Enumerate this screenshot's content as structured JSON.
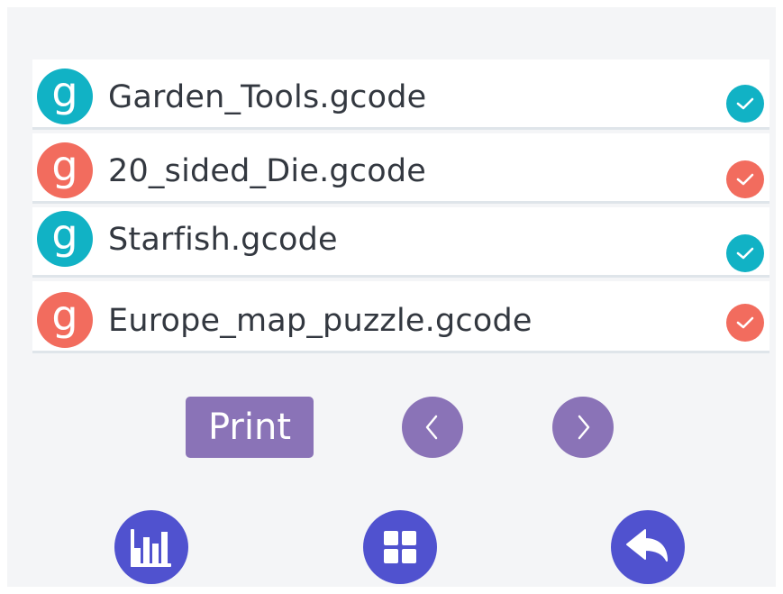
{
  "files": [
    {
      "name": "Garden_Tools.gcode",
      "icon_letter": "g",
      "color": "#11b2c5",
      "status": "check-icon"
    },
    {
      "name": "20_sided_Die.gcode",
      "icon_letter": "g",
      "color": "#f26c5e",
      "status": "check-icon"
    },
    {
      "name": "Starfish.gcode",
      "icon_letter": "g",
      "color": "#11b2c5",
      "status": "check-icon"
    },
    {
      "name": "Europe_map_puzzle.gcode",
      "icon_letter": "g",
      "color": "#f26c5e",
      "status": "check-icon"
    }
  ],
  "controls": {
    "print_label": "Print",
    "prev_icon": "chevron-left-icon",
    "next_icon": "chevron-right-icon"
  },
  "bottom_nav": [
    {
      "icon": "bar-chart-icon"
    },
    {
      "icon": "grid-icon"
    },
    {
      "icon": "back-arrow-icon"
    }
  ],
  "colors": {
    "teal": "#11b2c5",
    "coral": "#f26c5e",
    "purple": "#8a73b7",
    "nav_blue": "#5052cf"
  }
}
